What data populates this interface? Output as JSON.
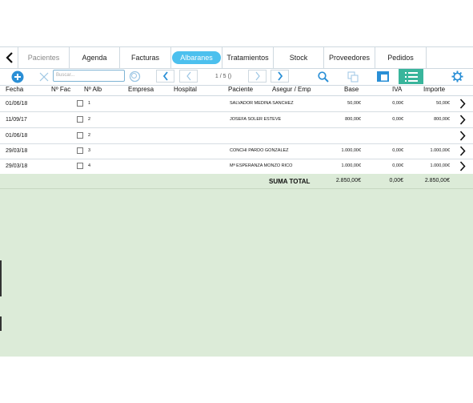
{
  "tabs": [
    {
      "label": "Pacientes",
      "state": "dim"
    },
    {
      "label": "Agenda",
      "state": "normal"
    },
    {
      "label": "Facturas",
      "state": "normal"
    },
    {
      "label": "Albaranes",
      "state": "active"
    },
    {
      "label": "Tratamientos",
      "state": "normal"
    },
    {
      "label": "Stock",
      "state": "normal"
    },
    {
      "label": "Proveedores",
      "state": "normal"
    },
    {
      "label": "Pedidos",
      "state": "normal"
    }
  ],
  "toolbar": {
    "search_placeholder": "Buscar...",
    "pager": "1 / 5 ()"
  },
  "columns": {
    "fecha": "Fecha",
    "nfac": "Nº Fac",
    "nalb": "Nº Alb",
    "empresa": "Empresa",
    "hospital": "Hospital",
    "paciente": "Paciente",
    "asegur": "Asegur / Emp",
    "base": "Base",
    "iva": "IVA",
    "importe": "Importe"
  },
  "rows": [
    {
      "fecha": "01/06/18",
      "nalb": "1",
      "paciente": "SALVADOR MEDINA SANCHEZ",
      "base": "50,00€",
      "iva": "0,00€",
      "importe": "50,00€"
    },
    {
      "fecha": "11/09/17",
      "nalb": "2",
      "paciente": "JOSEFA SOLER ESTEVE",
      "base": "800,00€",
      "iva": "0,00€",
      "importe": "800,00€"
    },
    {
      "fecha": "01/06/18",
      "nalb": "2",
      "paciente": "",
      "base": "",
      "iva": "",
      "importe": ""
    },
    {
      "fecha": "29/03/18",
      "nalb": "3",
      "paciente": "CONCHI PARDO GONZALEZ",
      "base": "1.000,00€",
      "iva": "0,00€",
      "importe": "1.000,00€"
    },
    {
      "fecha": "29/03/18",
      "nalb": "4",
      "paciente": "Mª ESPERANZA MONZO RICO",
      "base": "1.000,00€",
      "iva": "0,00€",
      "importe": "1.000,00€"
    }
  ],
  "total": {
    "label": "SUMA TOTAL",
    "base": "2.850,00€",
    "iva": "0,00€",
    "importe": "2.850,00€"
  },
  "colors": {
    "accent": "#4cc0ee",
    "green_button": "#39b59c",
    "summary_bg": "#dcebd8",
    "icon_blue": "#2a8fd6"
  }
}
